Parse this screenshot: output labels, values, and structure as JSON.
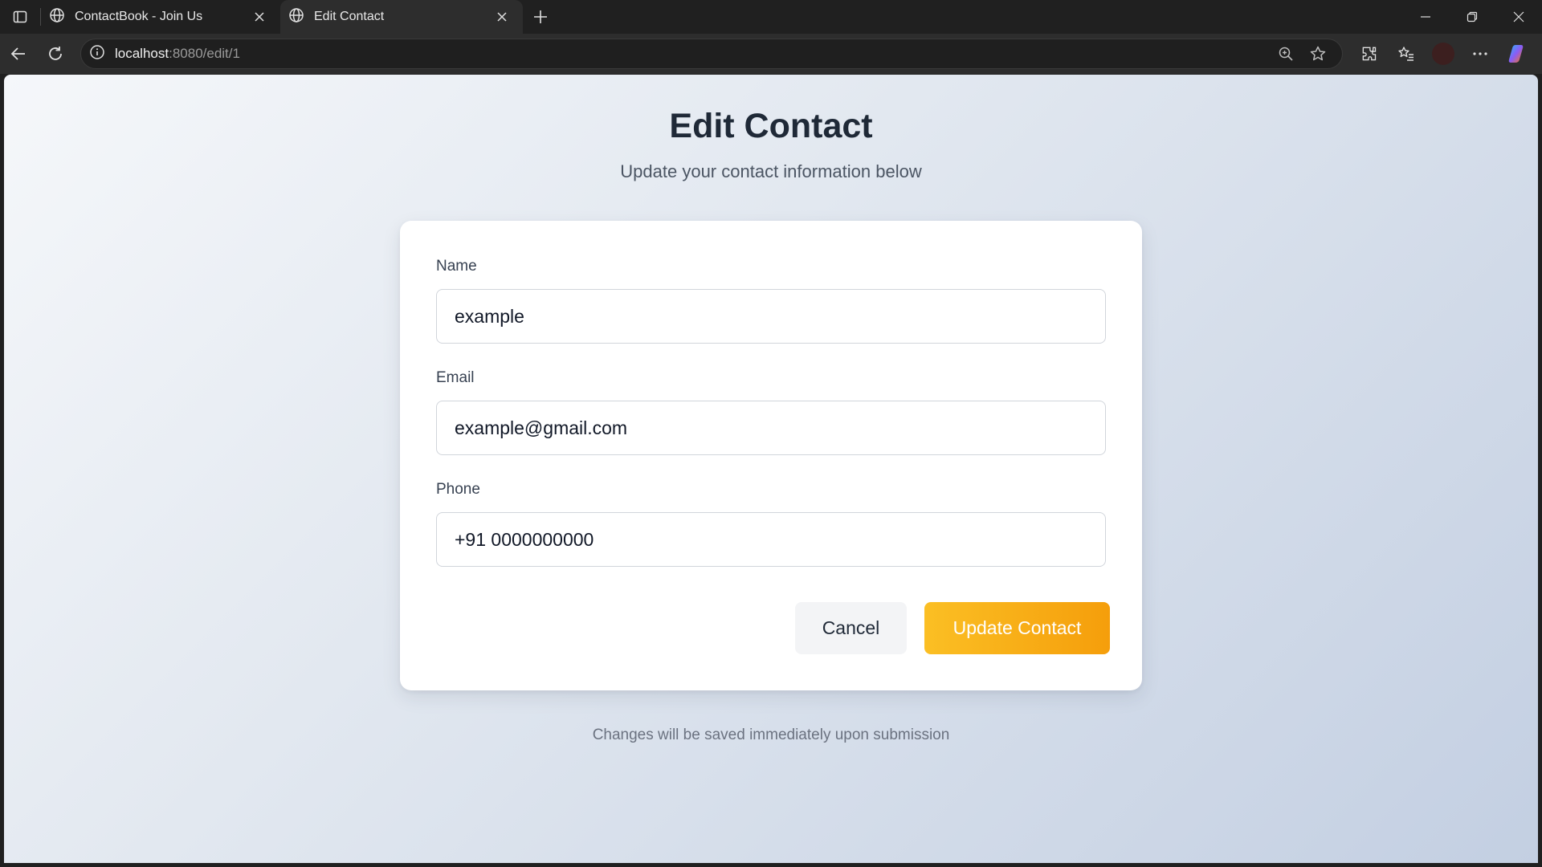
{
  "browser": {
    "tabs": [
      {
        "title": "ContactBook - Join Us",
        "active": false
      },
      {
        "title": "Edit Contact",
        "active": true
      }
    ],
    "address": {
      "host": "localhost",
      "path": ":8080/edit/1"
    }
  },
  "page": {
    "title": "Edit Contact",
    "subtitle": "Update your contact information below",
    "form": {
      "name_label": "Name",
      "name_value": "example",
      "email_label": "Email",
      "email_value": "example@gmail.com",
      "phone_label": "Phone",
      "phone_value": "+91 0000000000",
      "cancel_label": "Cancel",
      "submit_label": "Update Contact"
    },
    "footer_note": "Changes will be saved immediately upon submission"
  },
  "colors": {
    "accent": "#f59e0b",
    "accent_light": "#fbbf24",
    "title": "#1f2937"
  }
}
